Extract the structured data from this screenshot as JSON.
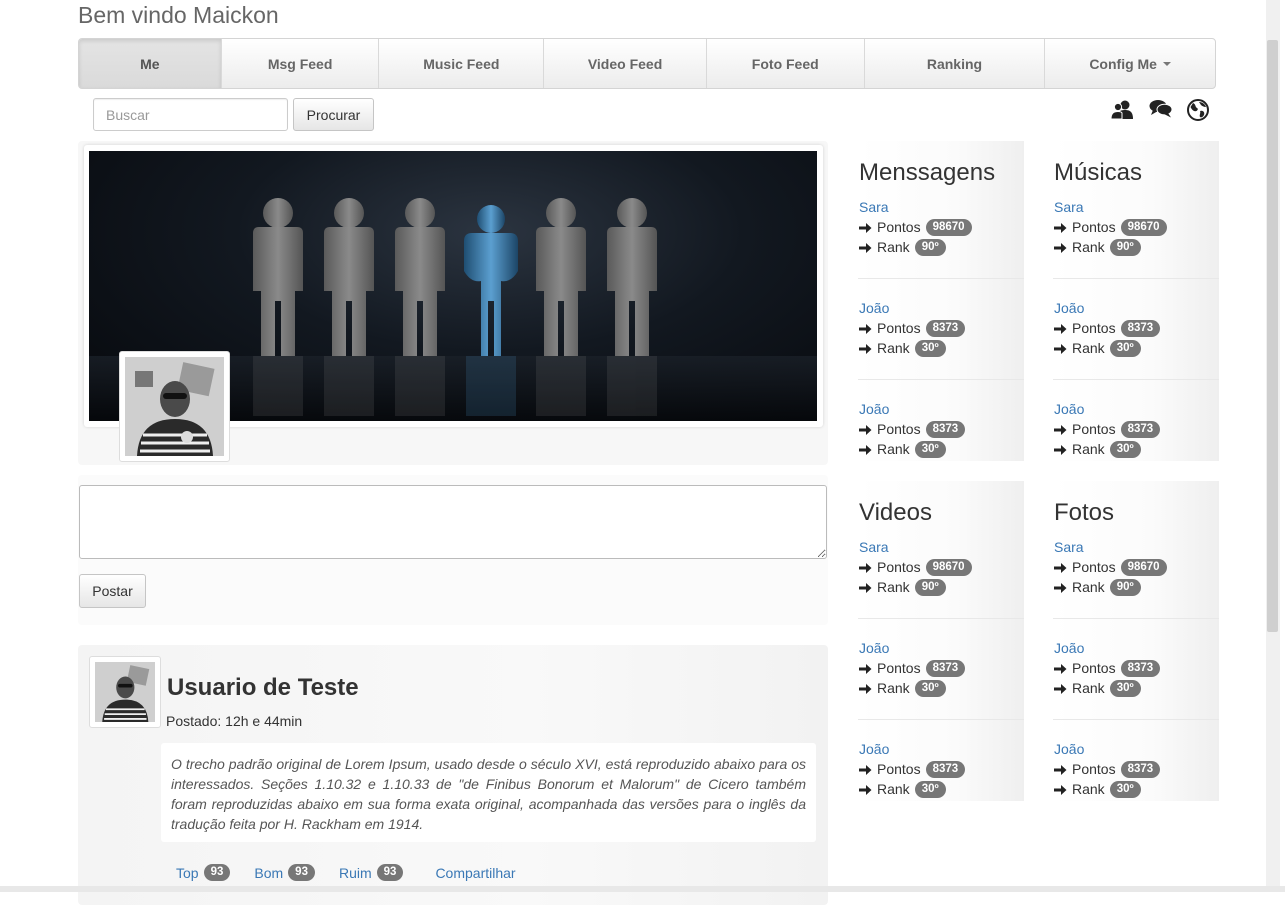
{
  "page": {
    "title": "Bem vindo Maickon"
  },
  "nav": {
    "items": [
      {
        "label": "Me",
        "active": true
      },
      {
        "label": "Msg Feed"
      },
      {
        "label": "Music Feed"
      },
      {
        "label": "Video Feed"
      },
      {
        "label": "Foto Feed"
      },
      {
        "label": "Ranking"
      },
      {
        "label": "Config Me",
        "dropdown": true
      }
    ]
  },
  "search": {
    "placeholder": "Buscar",
    "button_label": "Procurar"
  },
  "top_icons": [
    "users-icon",
    "chat-icon",
    "globe-icon"
  ],
  "post": {
    "button_label": "Postar"
  },
  "feed": {
    "user": "Usuario de Teste",
    "posted": "Postado: 12h e 44min",
    "text": "O trecho padrão original de Lorem Ipsum, usado desde o século XVI, está reproduzido abaixo para os interessados. Seções 1.10.32 e 1.10.33 de \"de Finibus Bonorum et Malorum\" de Cicero também foram reproduzidas abaixo em sua forma exata original, acompanhada das versões para o inglês da tradução feita por H. Rackham em 1914.",
    "actions": [
      {
        "label": "Top",
        "count": "93"
      },
      {
        "label": "Bom",
        "count": "93"
      },
      {
        "label": "Ruim",
        "count": "93"
      },
      {
        "label": "Compartilhar"
      }
    ]
  },
  "side": {
    "points_label": "Pontos",
    "rank_label": "Rank",
    "panels": [
      {
        "title": "Menssagens",
        "entries": [
          {
            "name": "Sara",
            "points": "98670",
            "rank": "90º"
          },
          {
            "name": "João",
            "points": "8373",
            "rank": "30º"
          },
          {
            "name": "João",
            "points": "8373",
            "rank": "30º"
          }
        ]
      },
      {
        "title": "Músicas",
        "entries": [
          {
            "name": "Sara",
            "points": "98670",
            "rank": "90º"
          },
          {
            "name": "João",
            "points": "8373",
            "rank": "30º"
          },
          {
            "name": "João",
            "points": "8373",
            "rank": "30º"
          }
        ]
      },
      {
        "title": "Videos",
        "entries": [
          {
            "name": "Sara",
            "points": "98670",
            "rank": "90º"
          },
          {
            "name": "João",
            "points": "8373",
            "rank": "30º"
          },
          {
            "name": "João",
            "points": "8373",
            "rank": "30º"
          }
        ]
      },
      {
        "title": "Fotos",
        "entries": [
          {
            "name": "Sara",
            "points": "98670",
            "rank": "90º"
          },
          {
            "name": "João",
            "points": "8373",
            "rank": "30º"
          },
          {
            "name": "João",
            "points": "8373",
            "rank": "30º"
          }
        ]
      }
    ]
  },
  "colors": {
    "link": "#3a78b5",
    "badge": "#777777",
    "figure_highlight": "#4a8fc2"
  }
}
